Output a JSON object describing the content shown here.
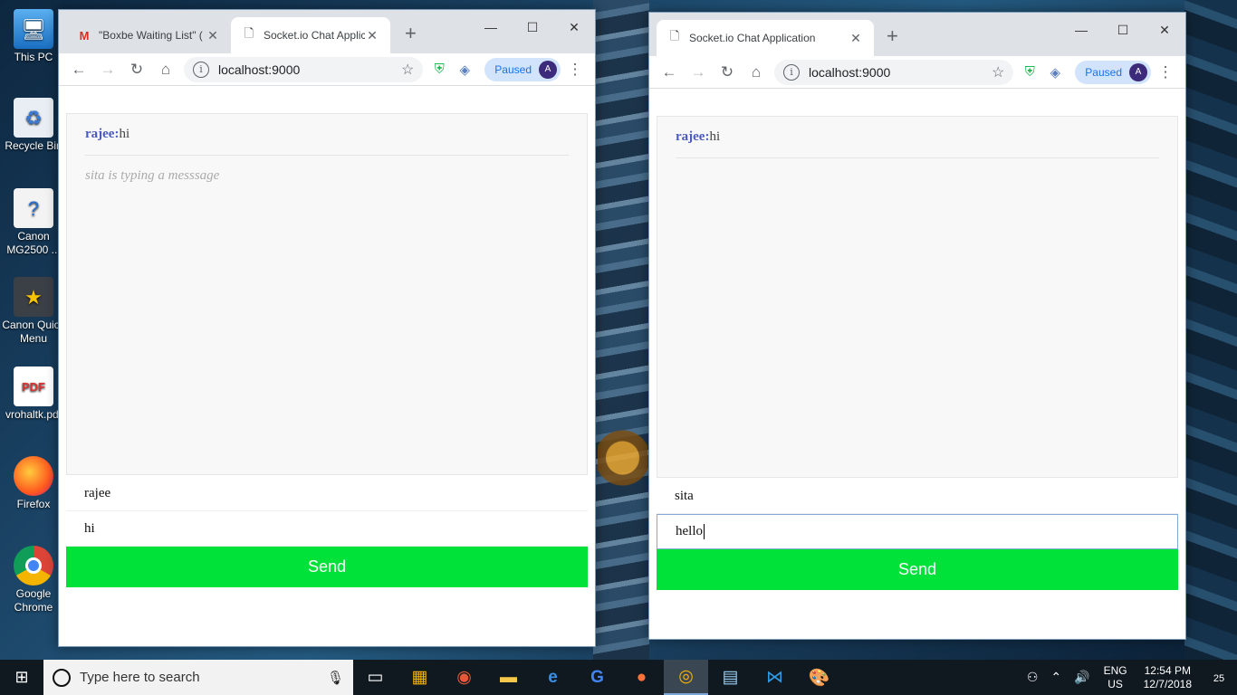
{
  "desktop": {
    "icons": [
      {
        "label": "This PC",
        "icon": "computer-icon"
      },
      {
        "label": "Recycle Bin",
        "icon": "recycle-bin-icon"
      },
      {
        "label": "Canon MG2500 ...",
        "icon": "printer-help-icon"
      },
      {
        "label": "Canon Quick Menu",
        "icon": "canon-quick-menu-icon"
      },
      {
        "label": "vrohaltk.pdf",
        "icon": "pdf-icon"
      },
      {
        "label": "Firefox",
        "icon": "firefox-icon"
      },
      {
        "label": "Google Chrome",
        "icon": "chrome-icon"
      }
    ]
  },
  "left_window": {
    "tabs": [
      {
        "title": "\"Boxbe Waiting List\" (",
        "icon": "gmail-icon",
        "active": false
      },
      {
        "title": "Socket.io Chat Applica",
        "icon": "page-icon",
        "active": true
      }
    ],
    "url": "localhost:9000",
    "paused_label": "Paused",
    "chat": {
      "messages": [
        {
          "user": "rajee:",
          "text": "hi"
        }
      ],
      "typing": "sita is typing a messsage",
      "name_value": "rajee",
      "message_value": "hi",
      "send_label": "Send"
    }
  },
  "right_window": {
    "tabs": [
      {
        "title": "Socket.io Chat Application",
        "icon": "page-icon",
        "active": true
      }
    ],
    "url": "localhost:9000",
    "paused_label": "Paused",
    "chat": {
      "messages": [
        {
          "user": "rajee:",
          "text": "hi"
        }
      ],
      "name_value": "sita",
      "message_value": "hello",
      "send_label": "Send"
    }
  },
  "taskbar": {
    "search_placeholder": "Type here to search",
    "apps": [
      "task-view-icon",
      "store-icon",
      "app-icon",
      "file-explorer-icon",
      "edge-icon",
      "google-icon",
      "firefox-icon",
      "chrome-icon",
      "notepad-icon",
      "vscode-icon",
      "paint-icon"
    ],
    "lang_top": "ENG",
    "lang_bottom": "US",
    "time": "12:54 PM",
    "date": "12/7/2018",
    "notification_count": "25"
  },
  "colors": {
    "send_button": "#00e23a",
    "username": "#4b5bbd",
    "paused_bg": "#d2e3fc"
  }
}
